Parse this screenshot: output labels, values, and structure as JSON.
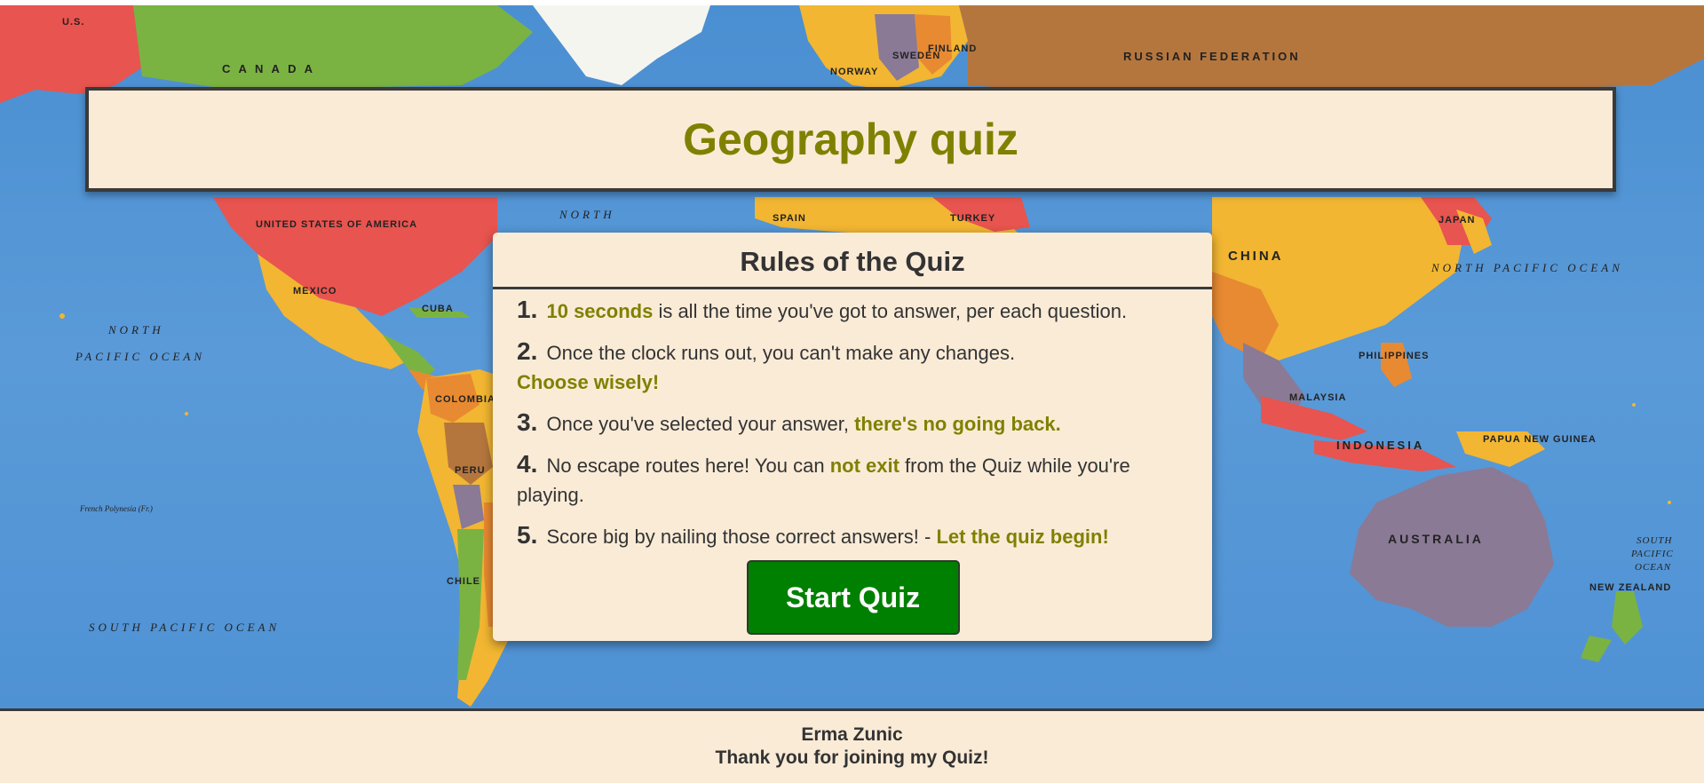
{
  "header": {
    "title": "Geography quiz"
  },
  "map": {
    "labels": {
      "us": "U.S.",
      "canada": "C A N A D A",
      "russia": "RUSSIAN FEDERATION",
      "usa": "UNITED STATES OF AMERICA",
      "mexico": "MEXICO",
      "china": "CHINA",
      "north_pacific_east": "NORTH PACIFIC OCEAN",
      "north_pacific_west_1": "NORTH",
      "north_pacific_west_2": "PACIFIC OCEAN",
      "north_mid": "NORTH",
      "south_pacific": "SOUTH PACIFIC OCEAN",
      "south_pacific_east_1": "SOUTH",
      "south_pacific_east_2": "PACIFIC",
      "south_pacific_east_3": "OCEAN",
      "french_polynesia": "French Polynesia (Fr.)",
      "indonesia": "INDONESIA",
      "australia": "AUSTRALIA",
      "new_zealand": "NEW ZEALAND",
      "papua": "PAPUA NEW GUINEA",
      "sweden": "SWEDEN",
      "finland": "FINLAND",
      "norway": "NORWAY",
      "spain": "SPAIN",
      "turkey": "TURKEY",
      "japan": "JAPAN",
      "philippines": "PHILIPPINES",
      "malaysia": "MALAYSIA",
      "colombia": "COLOMBIA",
      "peru": "PERU",
      "chile": "CHILE",
      "cuba": "CUBA"
    },
    "colors": {
      "ocean": "#5a9ad8",
      "ocean_light": "#7fb4e4",
      "yellow": "#f2b632",
      "green": "#7bb342",
      "red": "#e8544f",
      "brown": "#b5763e",
      "purple": "#8a7a96",
      "orange": "#e88a32"
    }
  },
  "rules": {
    "title": "Rules of the Quiz",
    "items": [
      {
        "num": "1.",
        "hl_before": "10 seconds",
        "text": " is all the time you've got to answer, per each question."
      },
      {
        "num": "2.",
        "text": " Once the clock runs out, you can't make any changes.",
        "hl_after": "Choose wisely!"
      },
      {
        "num": "3.",
        "text": " Once you've selected your answer, ",
        "hl_after": "there's no going back."
      },
      {
        "num": "4.",
        "text_before": " No escape routes here! You can ",
        "hl_mid": "not exit",
        "text_after": " from the Quiz while you're playing."
      },
      {
        "num": "5.",
        "text": " Score big by nailing those correct answers! - ",
        "hl_after": "Let the quiz begin!"
      }
    ],
    "start_label": "Start Quiz"
  },
  "footer": {
    "author": "Erma Zunic",
    "thanks": "Thank you for joining my Quiz!"
  }
}
